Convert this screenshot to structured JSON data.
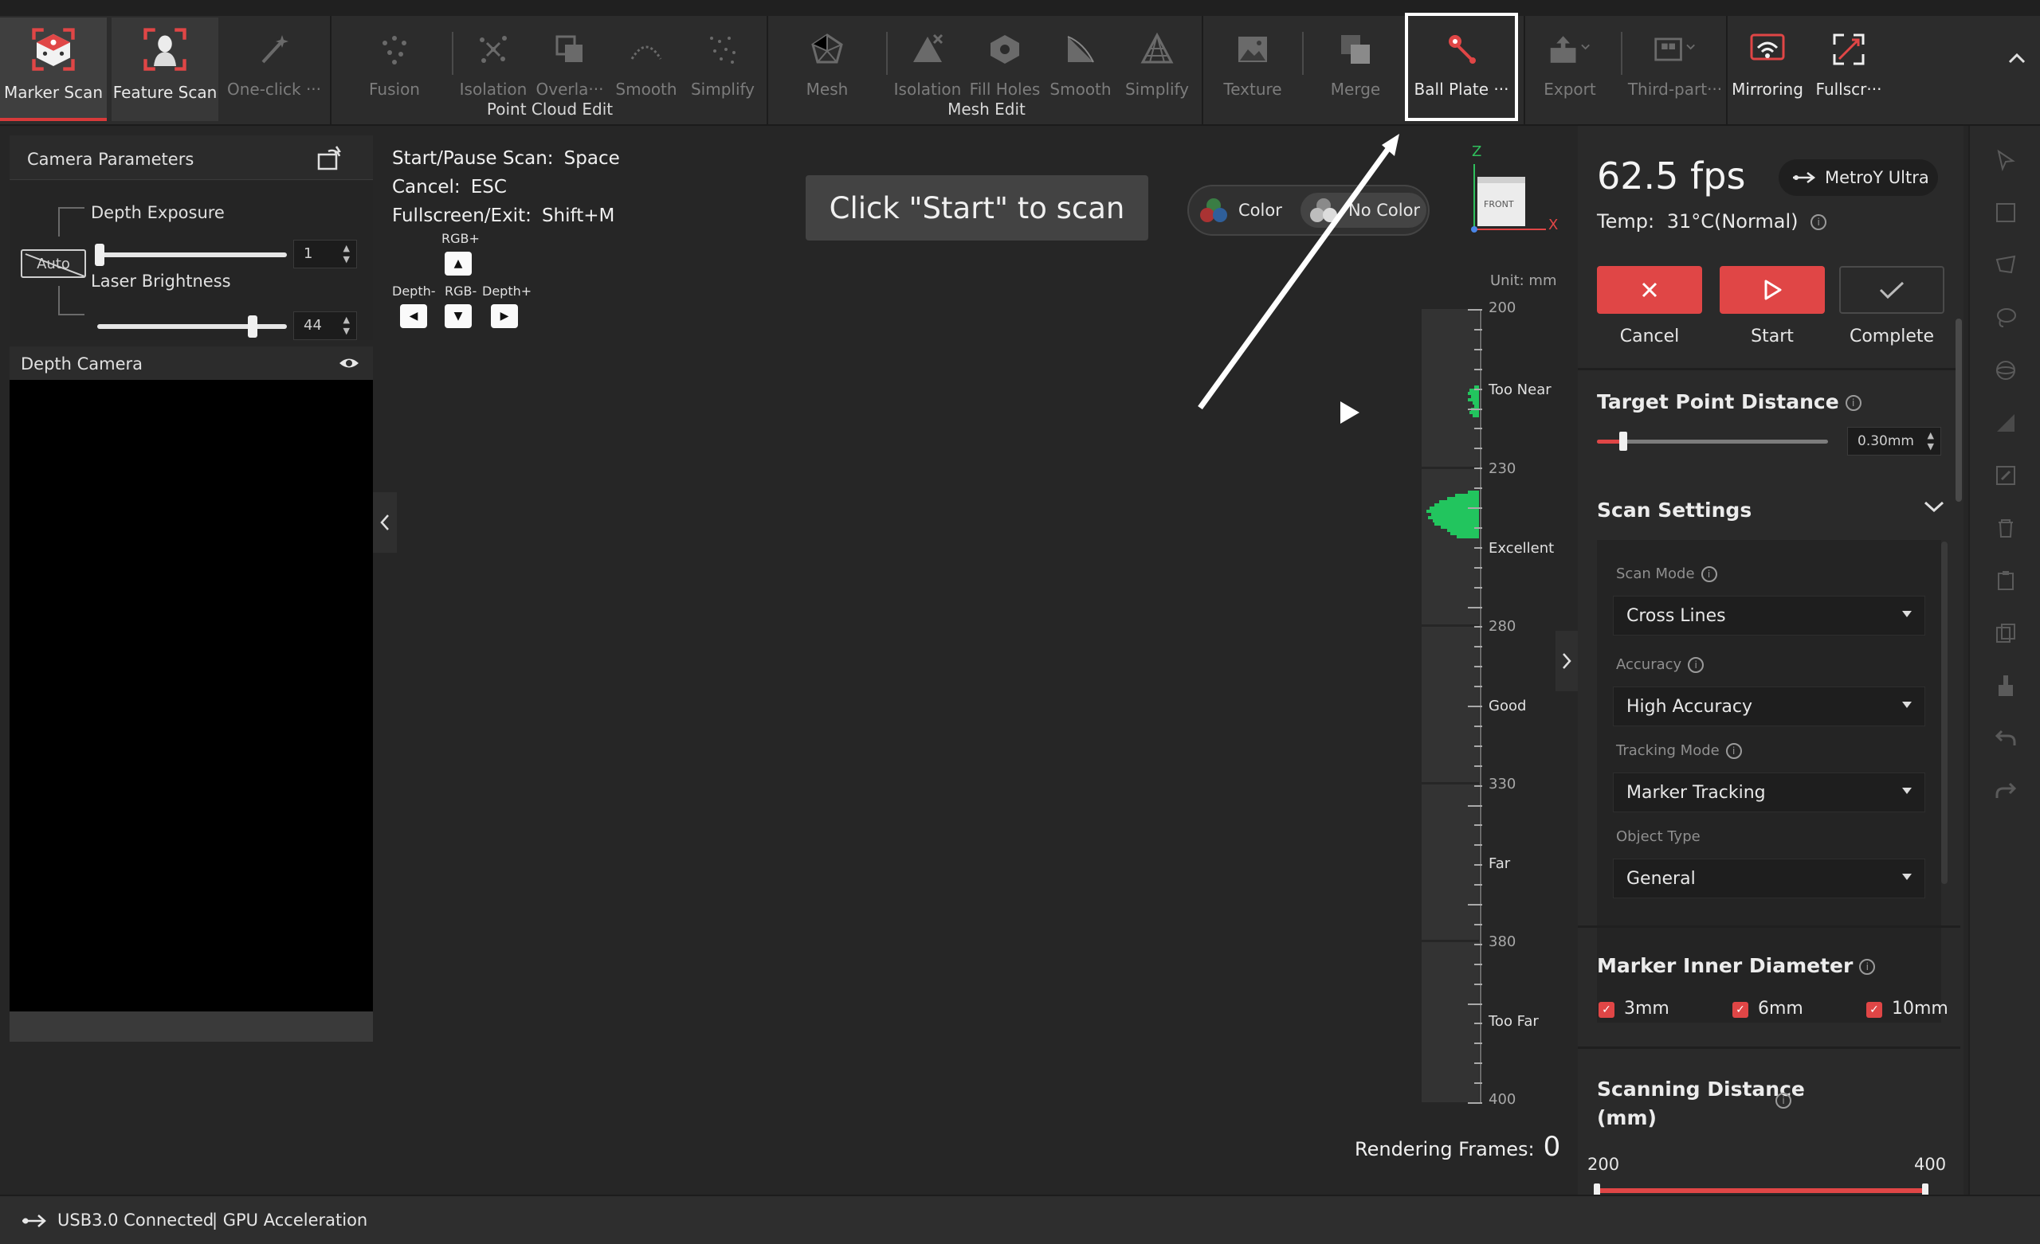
{
  "toolbar": {
    "marker_scan": "Marker Scan",
    "feature_scan": "Feature Scan",
    "one_click": "One-click ···",
    "fusion": "Fusion",
    "isolation": "Isolation",
    "overlap": "Overla···",
    "smooth": "Smooth",
    "simplify": "Simplify",
    "point_cloud_edit": "Point Cloud Edit",
    "mesh": "Mesh",
    "mesh_isolation": "Isolation",
    "fill_holes": "Fill Holes",
    "mesh_smooth": "Smooth",
    "mesh_simplify": "Simplify",
    "mesh_edit": "Mesh Edit",
    "texture": "Texture",
    "merge": "Merge",
    "ball_plate": "Ball Plate ···",
    "export": "Export",
    "third_party": "Third-part···",
    "mirroring": "Mirroring",
    "fullscreen": "Fullscr···"
  },
  "camera": {
    "title": "Camera Parameters",
    "depth_exposure_label": "Depth Exposure",
    "depth_exposure_value": "1",
    "depth_exposure_fraction": 0.02,
    "laser_brightness_label": "Laser Brightness",
    "laser_brightness_value": "44",
    "laser_brightness_fraction": 0.84,
    "auto_label": "Auto",
    "depth_camera_title": "Depth Camera"
  },
  "hotkeys": {
    "start_pause_label": "Start/Pause Scan:",
    "start_pause_key": "Space",
    "cancel_label": "Cancel:",
    "cancel_key": "ESC",
    "fullscreen_label": "Fullscreen/Exit:",
    "fullscreen_key": "Shift+M",
    "rgb_plus": "RGB+",
    "depth_minus": "Depth-",
    "rgb_minus": "RGB-",
    "depth_plus": "Depth+"
  },
  "viewport": {
    "start_hint": "Click \"Start\" to scan",
    "color_option": "Color",
    "no_color_option": "No Color",
    "axis_z": "Z",
    "axis_x": "X",
    "axis_cube_label": "FRONT",
    "unit": "Unit: mm",
    "rendering_frames_label": "Rendering Frames:",
    "rendering_frames_value": "0"
  },
  "gauge": {
    "numbers": [
      "200",
      "230",
      "280",
      "330",
      "380",
      "400"
    ],
    "zones": [
      "Too Near",
      "Excellent",
      "Good",
      "Far",
      "Too Far"
    ]
  },
  "right_panel": {
    "fps": "62.5 fps",
    "device_name": "MetroY Ultra",
    "temp_label": "Temp:",
    "temp_value": "31°C(Normal)",
    "cancel": "Cancel",
    "start": "Start",
    "complete": "Complete",
    "target_point_distance_title": "Target Point Distance",
    "target_point_distance_value": "0.30mm",
    "target_point_distance_fraction": 0.1,
    "scan_settings_title": "Scan Settings",
    "scan_mode_label": "Scan Mode",
    "scan_mode_value": "Cross Lines",
    "accuracy_label": "Accuracy",
    "accuracy_value": "High Accuracy",
    "tracking_mode_label": "Tracking Mode",
    "tracking_mode_value": "Marker Tracking",
    "object_type_label": "Object Type",
    "object_type_value": "General",
    "marker_diameter_title": "Marker Inner Diameter",
    "marker_3mm": "3mm",
    "marker_6mm": "6mm",
    "marker_10mm": "10mm",
    "scanning_distance_title_1": "Scanning Distance",
    "scanning_distance_title_2": "(mm)",
    "scanning_distance_min": "200",
    "scanning_distance_max": "400"
  },
  "status": {
    "usb": "USB3.0 Connected",
    "gpu": "| GPU Acceleration"
  },
  "colors": {
    "accent_red": "#e04646",
    "bar_green": "#22c55e",
    "background": "#262626"
  }
}
